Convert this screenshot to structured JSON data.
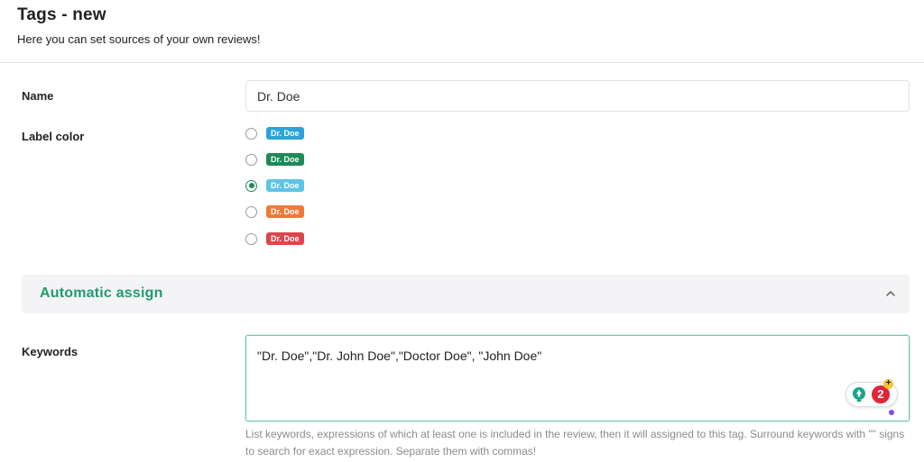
{
  "header": {
    "title": "Tags - new",
    "subtitle": "Here you can set sources of your own reviews!"
  },
  "name_field": {
    "label": "Name",
    "value": "Dr. Doe"
  },
  "label_color": {
    "label": "Label color",
    "options": [
      {
        "text": "Dr. Doe",
        "color": "#2aa3d9",
        "checked": false
      },
      {
        "text": "Dr. Doe",
        "color": "#1b8a57",
        "checked": false
      },
      {
        "text": "Dr. Doe",
        "color": "#5ec4e2",
        "checked": true
      },
      {
        "text": "Dr. Doe",
        "color": "#ed7a3a",
        "checked": false
      },
      {
        "text": "Dr. Doe",
        "color": "#d9474b",
        "checked": false
      }
    ]
  },
  "automatic_assign": {
    "title": "Automatic assign",
    "icon": "chevron-up-icon",
    "accent_color": "#1f9c6c"
  },
  "keywords": {
    "label": "Keywords",
    "value": "\"Dr. Doe\",\"Dr. John Doe\",\"Doctor Doe\", \"John Doe\"",
    "help_text": "List keywords, expressions of which at least one is included in the review, then it will assigned to this tag. Surround keywords with \"\" signs to search for exact expression. Separate them with commas!"
  },
  "grammar_widget": {
    "count": "2",
    "plus": "+",
    "icon": "bulb-icon"
  }
}
